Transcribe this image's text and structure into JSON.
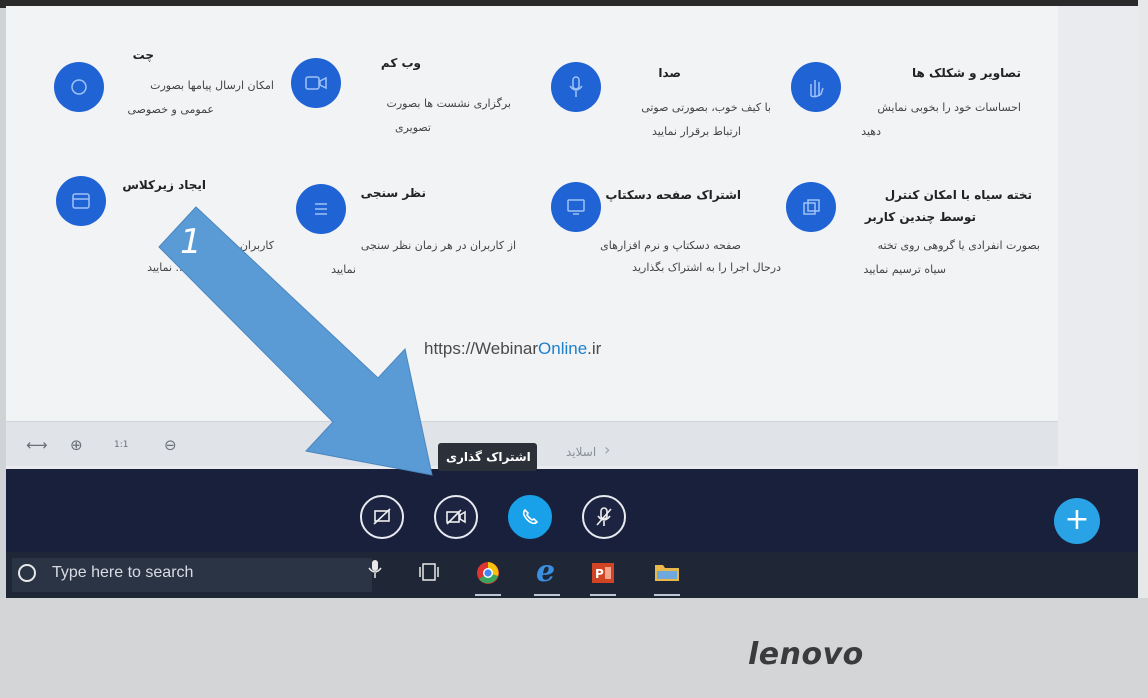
{
  "features": [
    {
      "title": "چت",
      "desc": [
        "امکان ارسال پیامها بصورت",
        "عمومی و خصوصی"
      ],
      "icon": "chat-icon"
    },
    {
      "title": "وب کم",
      "desc": [
        "برگزاری نشست ها بصورت",
        "تصویری"
      ],
      "icon": "webcam-icon"
    },
    {
      "title": "صدا",
      "desc": [
        "با کیف خوب، بصورتی صوتی",
        "ارتباط برقرار نمایید"
      ],
      "icon": "microphone-icon"
    },
    {
      "title": "تصاویر و شکلک ها",
      "desc": [
        "احساسات خود را بخوبی نمایش",
        "دهید"
      ],
      "icon": "emoji-hand-icon"
    },
    {
      "title": "ایجاد زیرکلاس",
      "desc": [
        "کاربران ... کوچکتر",
        "... نمایید"
      ],
      "icon": "subclass-icon"
    },
    {
      "title": "نظر سنجی",
      "desc": [
        "از کاربران در هر زمان نظر سنجی",
        "نمایید"
      ],
      "icon": "poll-icon"
    },
    {
      "title": "اشتراک صفحه دسکتاپ",
      "desc": [
        "صفحه دسکتاپ و نرم افزارهای",
        "درحال اجرا را به اشتراک بگذارید"
      ],
      "icon": "desktop-share-icon"
    },
    {
      "title": "تخته سیاه با امکان کنترل",
      "title2": "توسط چندین کاربر",
      "desc": [
        "بصورت انفرادی یا گروهی روی تخته",
        "سیاه ترسیم نمایید"
      ],
      "icon": "whiteboard-icon"
    }
  ],
  "url": {
    "prefix": "https://Webinar",
    "accent": "Online",
    "suffix": ".ir"
  },
  "slide_bar": {
    "slides_label": "اسلاید",
    "zoom_ratio": "1:1"
  },
  "tooltip": "اشتراک گذاری",
  "annotation": {
    "step": "1",
    "arrow_color": "#5b9bd5"
  },
  "taskbar": {
    "search_placeholder": "Type here to search"
  },
  "monitor_brand": "lenovo",
  "colors": {
    "accent_blue": "#1f63d4",
    "control_bar": "#18203c",
    "phone_blue": "#18a0e8"
  }
}
